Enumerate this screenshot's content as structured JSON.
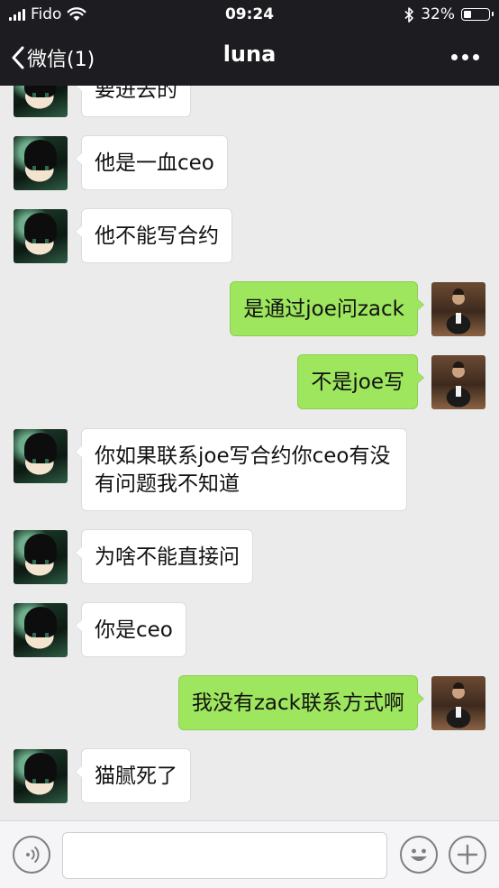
{
  "status_bar": {
    "carrier": "Fido",
    "time": "09:24",
    "battery_percent": "32%",
    "battery_level": 0.32
  },
  "nav": {
    "back_label": "微信(1)",
    "title": "luna",
    "more_icon": "ellipsis-icon"
  },
  "messages": [
    {
      "side": "in",
      "text": "要进去的"
    },
    {
      "side": "in",
      "text": "他是一血ceo"
    },
    {
      "side": "in",
      "text": "他不能写合约"
    },
    {
      "side": "out",
      "text": "是通过joe问zack"
    },
    {
      "side": "out",
      "text": "不是joe写"
    },
    {
      "side": "in",
      "text": "你如果联系joe写合约你ceo有没有问题我不知道"
    },
    {
      "side": "in",
      "text": "为啥不能直接问"
    },
    {
      "side": "in",
      "text": "你是ceo"
    },
    {
      "side": "out",
      "text": "我没有zack联系方式啊"
    },
    {
      "side": "in",
      "text": "猫腻死了"
    }
  ],
  "input_bar": {
    "value": "",
    "placeholder": "",
    "voice_icon": "voice-icon",
    "emoji_icon": "emoji-icon",
    "plus_icon": "plus-icon"
  },
  "colors": {
    "header_bg": "#1c1c21",
    "chat_bg": "#ebebeb",
    "incoming_bubble": "#ffffff",
    "outgoing_bubble": "#9ee65e"
  }
}
